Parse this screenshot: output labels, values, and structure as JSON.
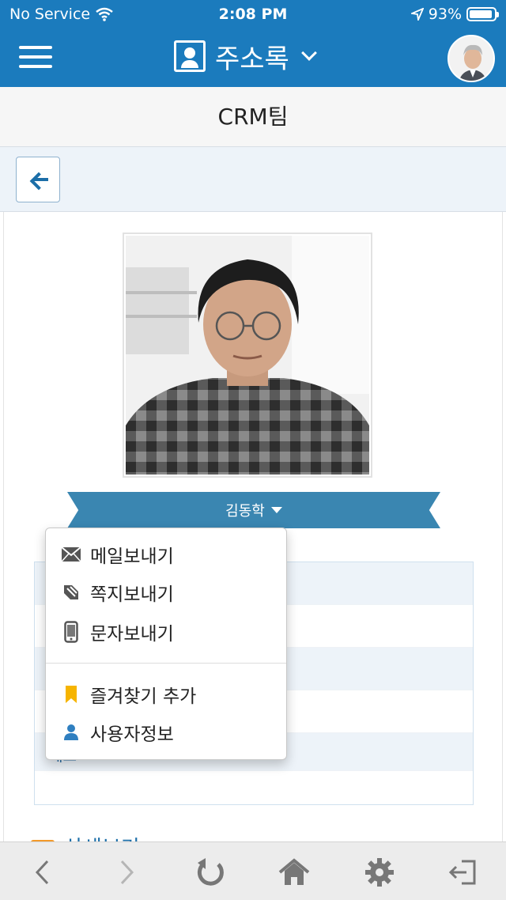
{
  "status_bar": {
    "carrier": "No Service",
    "time": "2:08 PM",
    "battery": "93%",
    "battery_level": 0.93,
    "icons": [
      "wifi-icon",
      "location-arrow-icon",
      "battery-icon"
    ]
  },
  "header": {
    "title": "주소록",
    "menu_icon": "hamburger-icon",
    "title_icon": "address-book-icon",
    "dropdown_icon": "chevron-down-icon",
    "background_color": "#1b7bbd"
  },
  "team": {
    "name": "CRM팀"
  },
  "toolbar": {
    "back_icon": "arrow-left-icon"
  },
  "profile": {
    "name": "김동학",
    "ribbon_color": "#3a86b1"
  },
  "context_menu": {
    "items": [
      {
        "label": "메일보내기",
        "icon": "envelope-icon"
      },
      {
        "label": "쪽지보내기",
        "icon": "note-icon"
      },
      {
        "label": "문자보내기",
        "icon": "mobile-phone-icon"
      },
      {
        "label": "즐겨찾기 추가",
        "icon": "bookmark-icon"
      },
      {
        "label": "사용자정보",
        "icon": "user-icon"
      }
    ]
  },
  "details": {
    "memo_label": "메모"
  },
  "section": {
    "label": "상세보기"
  },
  "bottom_nav": {
    "items": [
      {
        "icon": "back-arrow-icon"
      },
      {
        "icon": "forward-arrow-icon"
      },
      {
        "icon": "reload-icon"
      },
      {
        "icon": "home-icon"
      },
      {
        "icon": "gear-icon"
      },
      {
        "icon": "logout-icon"
      }
    ]
  }
}
